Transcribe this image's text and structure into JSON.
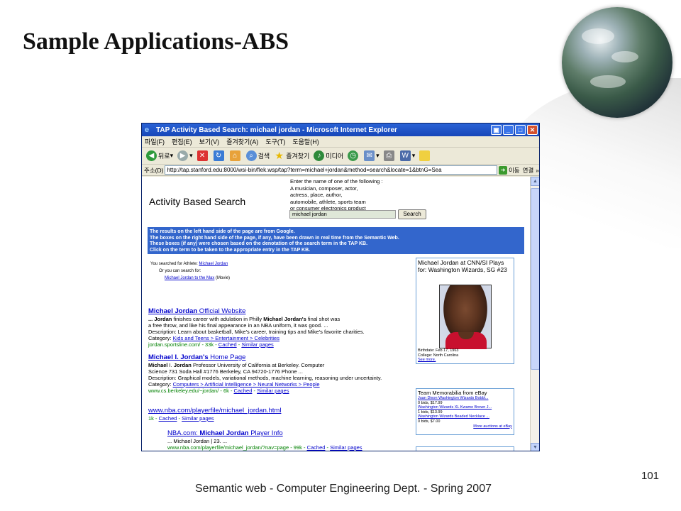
{
  "slide": {
    "title": "Sample Applications-ABS",
    "footer": "Semantic web - Computer  Engineering Dept. - Spring 2007",
    "page_number": "101"
  },
  "browser": {
    "window_title": "TAP Activity Based Search: michael jordan - Microsoft Internet Explorer",
    "menu": [
      "파일(F)",
      "편집(E)",
      "보기(V)",
      "즐겨찾기(A)",
      "도구(T)",
      "도움말(H)"
    ],
    "toolbar": {
      "back_label": "뒤로",
      "search_label": "검색",
      "favorites_label": "즐겨찾기",
      "media_label": "미디어"
    },
    "address": {
      "label": "주소(D)",
      "url": "http://tap.stanford.edu:8000/wsi-bin/flek.wsp/tap?term=michael+jordan&method=search&locate=1&btnG=Sea",
      "go_label": "이동",
      "links_label": "연결"
    }
  },
  "page": {
    "heading": "Activity Based Search",
    "instructions": [
      "Enter the name of one of the following :",
      "A musician, composer, actor,",
      "actress, place, author,",
      "automobile, athlete, sports team",
      "or consumer electronics product"
    ],
    "search_value": "michael jordan",
    "search_button": "Search",
    "banner": [
      "The results on the left hand side of the page are from Google.",
      "The boxes on the right hand side of the page, if any, have been drawn in real time from the Semantic Web.",
      "These boxes (if any) were chosen based on the denotation of the search term in the TAP KB.",
      "Click on the term to be taken to the appropriate entry in the TAP KB."
    ],
    "you_searched_prefix": "You searched for Athlete: ",
    "you_searched_link": "Michael Jordan",
    "or_search_for": "Or you can search for:",
    "alt_link": "Michael Jordan to the Max",
    "alt_suffix": " (Movie)",
    "results": [
      {
        "title_bold": "Michael Jordan",
        "title_rest": " Official Website",
        "snippet1_a": "... ",
        "snippet1_b": "Jordan",
        "snippet1_c": " finishes career with adulation in Philly ",
        "snippet1_d": "Michael Jordan's",
        "snippet1_e": " final shot was",
        "snippet2": "a free throw, and like his final appearance in an NBA uniform, it was good. ...",
        "desc": "Description: Learn about basketball, Mike's career, training tips and Mike's favorite charities.",
        "cat_prefix": "Category: ",
        "cat_link": "Kids and Teens > Entertainment > Celebrities",
        "url": "jordan.sportsline.com/ - 33k - ",
        "cached": "Cached",
        "sep": " - ",
        "similar": "Similar pages"
      },
      {
        "title_bold": "Michael I. Jordan's",
        "title_rest": " Home Page",
        "snippet1_a": "Michael",
        "snippet1_b": " I. ",
        "snippet1_c": "Jordan",
        "snippet1_d": " Professor University of California at Berkeley. Computer",
        "snippet2": "Science 731 Soda Hall #1776 Berkeley, CA 94720-1776 Phone ...",
        "desc": "Description: Graphical models, variational methods, machine learning, reasoning under uncertainty.",
        "cat_prefix": "Category: ",
        "cat_link": "Computers > Artificial Intelligence > Neural Networks > People",
        "url": "www.cs.berkeley.edu/~jordan/ - 6k - ",
        "cached": "Cached",
        "sep": " - ",
        "similar": "Similar pages"
      },
      {
        "title": "www.nba.com/playerfile/michael_jordan.html",
        "url": "1k - ",
        "cached": "Cached",
        "sep": " - ",
        "similar": "Similar pages"
      },
      {
        "title_pre": "NBA.com: ",
        "title_bold": "Michael Jordan",
        "title_rest": " Player Info",
        "snippet1": "... Michael Jordan | 23. ...",
        "url": "www.nba.com/playerfile/michael_jordan/?nav=page - 99k - ",
        "cached": "Cached",
        "sep": " - ",
        "similar": "Similar pages"
      }
    ],
    "player_box": {
      "title": "Michael Jordan at CNN/SI Plays for: Washington Wizards, SG #23",
      "birthdate": "Birthdate: Feb 17, 1963",
      "college": "College: North Carolina",
      "see_more": "See more."
    },
    "ebay_box": {
      "title": "Team Memorabilia from eBay",
      "items": [
        {
          "name": "Juan Dixon Washington Wizards Bobbl...",
          "bids": "0 bids, $17.99"
        },
        {
          "name": "Washington Wizards XL Kwame Brown J...",
          "bids": "1 bids, $13.99"
        },
        {
          "name": "Washington Wizards Beaded Necklace ...",
          "bids": "0 bids, $7.00"
        }
      ],
      "more": "More auctions at eBay"
    }
  }
}
